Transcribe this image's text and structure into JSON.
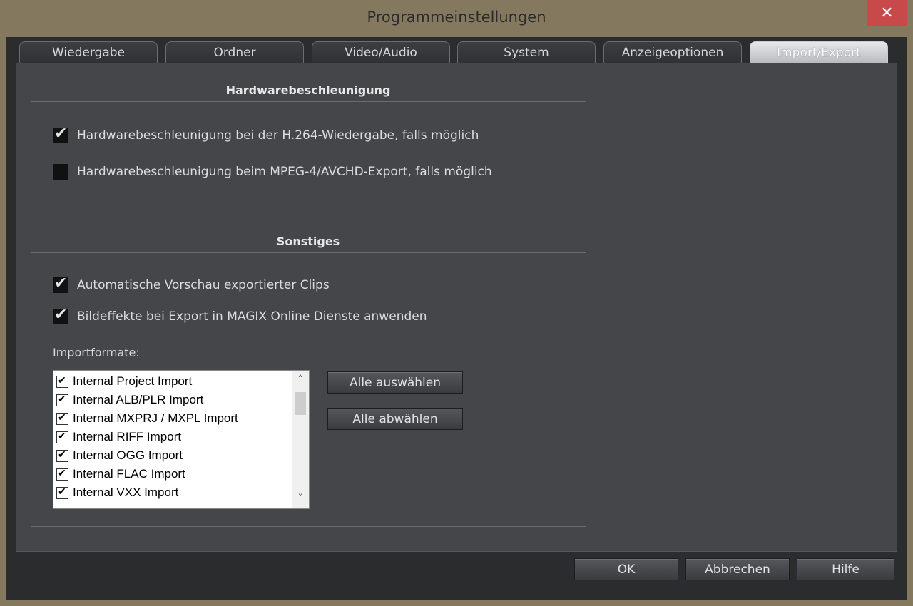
{
  "window": {
    "title": "Programmeinstellungen",
    "close_glyph": "✕"
  },
  "tabs": [
    {
      "label": "Wiedergabe"
    },
    {
      "label": "Ordner"
    },
    {
      "label": "Video/Audio"
    },
    {
      "label": "System"
    },
    {
      "label": "Anzeigeoptionen"
    },
    {
      "label": "Import/Export",
      "active": true
    }
  ],
  "hardware": {
    "title": "Hardwarebeschleunigung",
    "options": [
      {
        "label": "Hardwarebeschleunigung bei der H.264-Wiedergabe, falls möglich",
        "checked": true
      },
      {
        "label": "Hardwarebeschleunigung beim MPEG-4/AVCHD-Export, falls möglich",
        "checked": false
      }
    ]
  },
  "misc": {
    "title": "Sonstiges",
    "options": [
      {
        "label": "Automatische Vorschau exportierter Clips",
        "checked": true
      },
      {
        "label": "Bildeffekte bei Export in MAGIX Online Dienste anwenden",
        "checked": true
      }
    ],
    "import_label": "Importformate:",
    "import_formats": [
      "Internal Project Import",
      "Internal ALB/PLR Import",
      "Internal MXPRJ / MXPL Import",
      "Internal RIFF Import",
      "Internal OGG Import",
      "Internal FLAC Import",
      "Internal VXX Import"
    ],
    "select_all": "Alle auswählen",
    "deselect_all": "Alle abwählen"
  },
  "footer": {
    "ok": "OK",
    "cancel": "Abbrechen",
    "help": "Hilfe"
  },
  "icons": {
    "close": "close-icon",
    "scroll_up": "chevron-up-icon",
    "scroll_down": "chevron-down-icon",
    "check": "checkmark-icon"
  }
}
